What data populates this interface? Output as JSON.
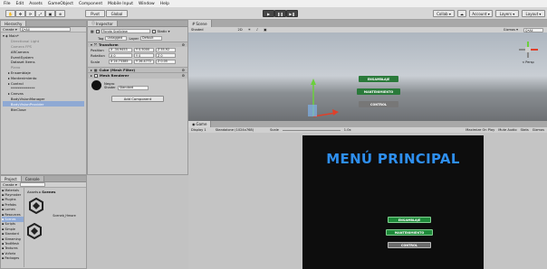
{
  "menubar": {
    "items": [
      "File",
      "Edit",
      "Assets",
      "GameObject",
      "Component",
      "Mobile Input",
      "Window",
      "Help"
    ]
  },
  "toolbar": {
    "pivot_label": "Pivot",
    "global_label": "Global",
    "collab_label": "Collab ▾",
    "account_label": "Account ▾",
    "layers_label": "Layers ▾",
    "layout_label": "Layout ▾"
  },
  "hierarchy": {
    "tab_label": "Hierarchy",
    "create_label": "Create ▾",
    "search_placeholder": "Q•All",
    "scene_name": "Main*",
    "items": [
      {
        "label": "Directional Light",
        "dim": true
      },
      {
        "label": "Camera FPS",
        "dim": true
      },
      {
        "label": "ARCamera",
        "dim": false
      },
      {
        "label": "EventSystem",
        "dim": false
      },
      {
        "label": "Dataset Items",
        "dim": false
      },
      {
        "label": "Plano",
        "dim": true
      },
      {
        "label": "Ensamblaje",
        "dim": false
      },
      {
        "label": "Mantenimiento",
        "dim": false
      },
      {
        "label": "Control",
        "dim": false
      },
      {
        "label": "**************",
        "dim": false
      },
      {
        "label": "Canvas",
        "dim": false
      },
      {
        "label": "BodyVisionManager",
        "dim": false
      },
      {
        "label": "BodyVisionProvider",
        "dim": false,
        "selected": true
      },
      {
        "label": "BtnClose",
        "dim": false
      }
    ]
  },
  "inspector": {
    "tab_label": "Inspector",
    "object_name": "Fondo Scollview",
    "static_label": "Static ▾",
    "tag_label": "Tag",
    "tag_value": "Untagged",
    "layer_label": "Layer",
    "layer_value": "Default",
    "transform_label": "Transform",
    "position_label": "Position",
    "rotation_label": "Rotation",
    "scale_label": "Scale",
    "position": {
      "x": "X -34.9453",
      "y": "Y 0.5000",
      "z": "Z 55.92"
    },
    "rotation": {
      "x": "X 0",
      "y": "Y 0",
      "z": "Z 0"
    },
    "scale": {
      "x": "X 24.73385",
      "y": "Y 26.4772",
      "z": "Z 0.05"
    },
    "mesh_filter_label": "Cube (Mesh Filter)",
    "mesh_renderer_label": "Mesh Renderer",
    "material_name": "Negro",
    "shader_label": "Shader",
    "shader_value": "Standard",
    "add_component_label": "Add Component"
  },
  "project": {
    "tab_label": "Project",
    "console_tab_label": "Console",
    "create_label": "Create ▾",
    "breadcrumb_root": "Assets",
    "breadcrumb_sep": "▸",
    "breadcrumb_current": "Scenes",
    "folders": [
      "Materials",
      "Playmaker",
      "Plugins",
      "Prefabs",
      "Lumen",
      "Resources",
      "Scenes",
      "Scripts",
      "Simple",
      "Standard",
      "Streaming",
      "TextMesh",
      "Textures",
      "Vuforia",
      "Packages"
    ],
    "asset_label": "Sceneb_Hmore"
  },
  "scene_view": {
    "tab_label": "Scene",
    "shading_label": "Shaded",
    "mode_2d_label": "2D",
    "gizmos_label": "Gizmos ▾",
    "search_placeholder": "Q•All",
    "buttons": [
      "ENSAMBLAJE",
      "MANTENIMIENTO",
      "CONTROL"
    ],
    "persp_label": "< Persp"
  },
  "game_view": {
    "tab_label": "Game",
    "display_label": "Display 1",
    "resolution_label": "Standalone (1024x768)",
    "scale_label": "Scale",
    "scale_value": "1.0x",
    "options": [
      "Maximize On Play",
      "Mute Audio",
      "Stats",
      "Gizmos"
    ],
    "title": "MENÚ PRINCIPAL",
    "buttons": [
      "ENSAMBLAJE",
      "MANTENIMIENTO",
      "CONTROL"
    ]
  },
  "colors": {
    "game_bg": "#0d0d0d",
    "title_blue": "#2e8ff0",
    "btn_green": "#1f8a3a",
    "btn_blue": "#1f6fb8",
    "btn_gray": "#6d6d6d",
    "selection": "#8fa9d4"
  }
}
